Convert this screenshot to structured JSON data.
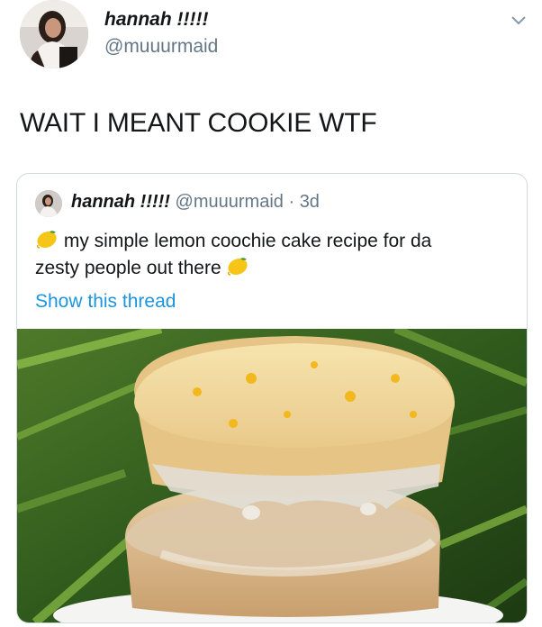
{
  "tweet": {
    "author_name": "hannah !!!!!",
    "author_handle": "@muuurmaid",
    "text": "WAIT I MEANT COOKIE WTF"
  },
  "quoted_tweet": {
    "author_name": "hannah !!!!!",
    "author_handle": "@muuurmaid",
    "separator": "·",
    "time": "3d",
    "line1": "my simple lemon coochie cake recipe for da",
    "line2": "zesty people out there",
    "show_thread": "Show this thread"
  },
  "icons": {
    "menu": "chevron-down-icon",
    "emoji": "lemon-emoji-icon"
  },
  "colors": {
    "text": "#14171a",
    "secondary": "#657786",
    "link": "#1b95e0",
    "border": "#cfd9de"
  }
}
